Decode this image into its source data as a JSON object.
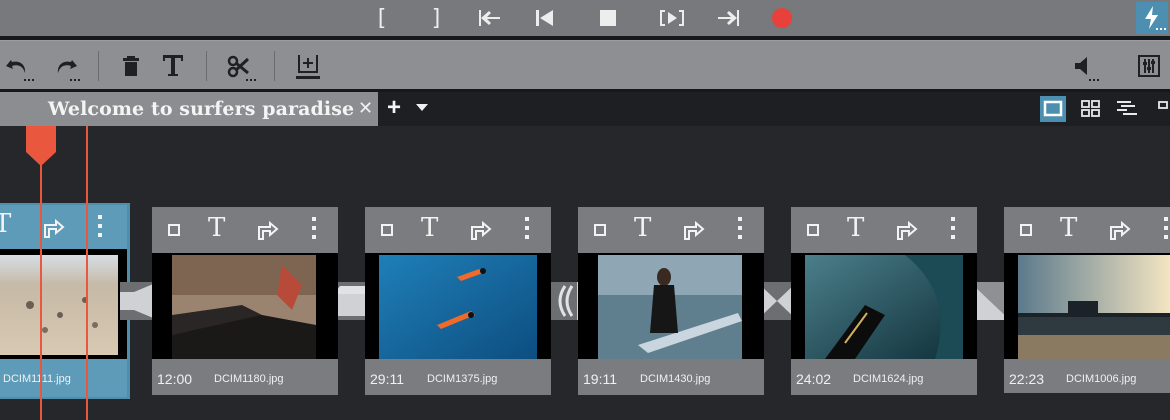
{
  "tab": {
    "title": "Welcome to surfers paradise",
    "close": "✕",
    "add": "+"
  },
  "transport": {
    "in_mark": "[",
    "out_mark": "]",
    "record_color": "#e8403a",
    "icons": [
      "mark-in-icon",
      "mark-out-icon",
      "jump-to-start-icon",
      "prev-marker-icon",
      "stop-icon",
      "play-range-icon",
      "jump-to-end-icon",
      "record-icon",
      "quick-export-icon"
    ]
  },
  "toolbar": {
    "icons": [
      "undo-icon",
      "redo-icon",
      "delete-icon",
      "title-icon",
      "scissors-icon",
      "insert-icon",
      "volume-icon",
      "mixer-icon"
    ]
  },
  "view_modes": [
    "storyboard-view-icon",
    "grid-view-icon",
    "timeline-view-icon"
  ],
  "accent_color": "#e9573f",
  "clips": [
    {
      "duration": "",
      "name": "DCIM1111.jpg",
      "selected": true
    },
    {
      "duration": "12:00",
      "name": "DCIM1180.jpg"
    },
    {
      "duration": "29:11",
      "name": "DCIM1375.jpg"
    },
    {
      "duration": "19:11",
      "name": "DCIM1430.jpg"
    },
    {
      "duration": "24:02",
      "name": "DCIM1624.jpg"
    },
    {
      "duration": "22:23",
      "name": "DCIM1006.jpg"
    }
  ]
}
